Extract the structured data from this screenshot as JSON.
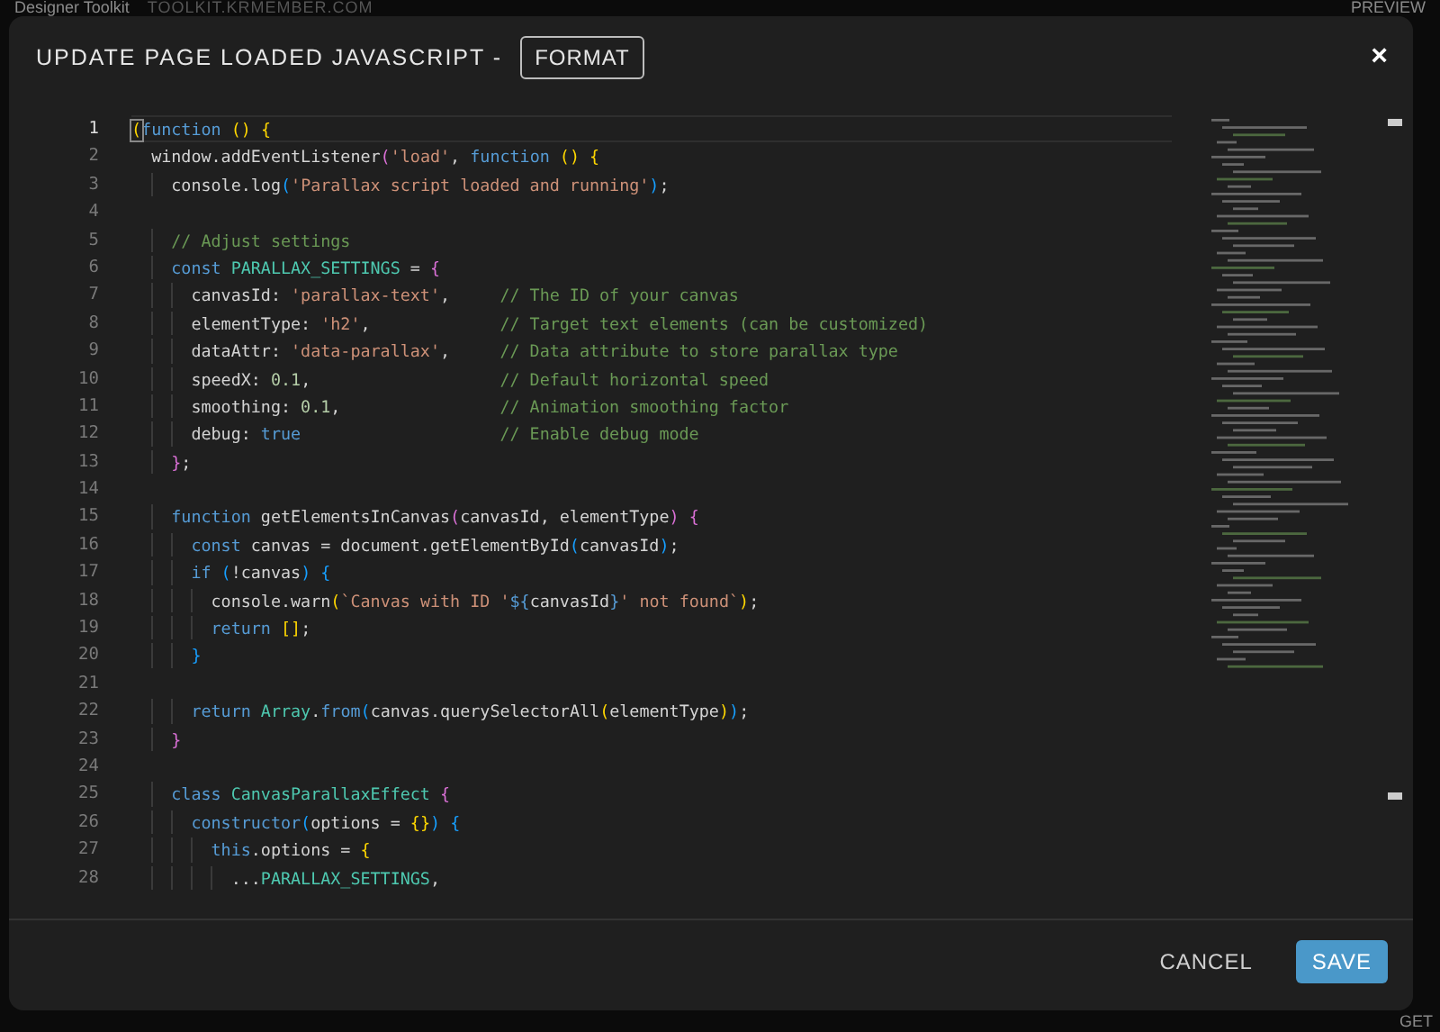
{
  "background": {
    "app_name": "Designer Toolkit",
    "domain": "TOOLKIT.KRMEMBER.COM",
    "preview": "PREVIEW",
    "corner_text": "GET"
  },
  "dialog": {
    "title": "UPDATE PAGE LOADED JAVASCRIPT -",
    "format_button": "FORMAT",
    "close": "×",
    "editor": {
      "lines": [
        {
          "number": "1",
          "selected": true,
          "tokens": [
            {
              "text": "(",
              "kind": "gold"
            },
            {
              "text": "function",
              "kind": "keyword"
            },
            {
              "text": " () {",
              "kind": "gold"
            }
          ]
        },
        {
          "number": "2",
          "selected": false,
          "tokens": [
            {
              "text": "  window.addEventListener",
              "kind": "plain"
            },
            {
              "text": "(",
              "kind": "violet"
            },
            {
              "text": "'load'",
              "kind": "string"
            },
            {
              "text": ", ",
              "kind": "plain"
            },
            {
              "text": "function",
              "kind": "keyword"
            },
            {
              "text": " () {",
              "kind": "gold"
            }
          ]
        },
        {
          "number": "3",
          "selected": false,
          "tokens": [
            {
              "text": "    console.log",
              "kind": "plain"
            },
            {
              "text": "(",
              "kind": "blue"
            },
            {
              "text": "'Parallax script loaded and running'",
              "kind": "string"
            },
            {
              "text": ")",
              "kind": "blue"
            },
            {
              "text": ";",
              "kind": "plain"
            }
          ]
        },
        {
          "number": "4",
          "selected": false
        },
        {
          "number": "5",
          "selected": false,
          "tokens": [
            {
              "text": "    // Adjust settings",
              "kind": "comment"
            }
          ]
        },
        {
          "number": "6",
          "selected": false,
          "tokens": [
            {
              "text": "    const",
              "kind": "keyword"
            },
            {
              "text": " PARALLAX_SETTINGS",
              "kind": "type"
            },
            {
              "text": " = ",
              "kind": "plain"
            },
            {
              "text": "{",
              "kind": "violet"
            }
          ]
        },
        {
          "number": "7",
          "selected": false,
          "tokens": [
            {
              "text": "      canvasId: ",
              "kind": "plain"
            },
            {
              "text": "'parallax-text'",
              "kind": "string"
            },
            {
              "text": ",     ",
              "kind": "plain"
            },
            {
              "text": "// The ID of your canvas",
              "kind": "comment"
            }
          ]
        },
        {
          "number": "8",
          "selected": false,
          "tokens": [
            {
              "text": "      elementType: ",
              "kind": "plain"
            },
            {
              "text": "'h2'",
              "kind": "string"
            },
            {
              "text": ",             ",
              "kind": "plain"
            },
            {
              "text": "// Target text elements (can be customized)",
              "kind": "comment"
            }
          ]
        },
        {
          "number": "9",
          "selected": false,
          "tokens": [
            {
              "text": "      dataAttr: ",
              "kind": "plain"
            },
            {
              "text": "'data-parallax'",
              "kind": "string"
            },
            {
              "text": ",     ",
              "kind": "plain"
            },
            {
              "text": "// Data attribute to store parallax type",
              "kind": "comment"
            }
          ]
        },
        {
          "number": "10",
          "selected": false,
          "tokens": [
            {
              "text": "      speedX: ",
              "kind": "plain"
            },
            {
              "text": "0.1",
              "kind": "number"
            },
            {
              "text": ",                   ",
              "kind": "plain"
            },
            {
              "text": "// Default horizontal speed",
              "kind": "comment"
            }
          ]
        },
        {
          "number": "11",
          "selected": false,
          "tokens": [
            {
              "text": "      smoothing: ",
              "kind": "plain"
            },
            {
              "text": "0.1",
              "kind": "number"
            },
            {
              "text": ",                ",
              "kind": "plain"
            },
            {
              "text": "// Animation smoothing factor",
              "kind": "comment"
            }
          ]
        },
        {
          "number": "12",
          "selected": false,
          "tokens": [
            {
              "text": "      debug: ",
              "kind": "plain"
            },
            {
              "text": "true",
              "kind": "keyword"
            },
            {
              "text": "                    // Enable debug mode",
              "kind": "comment"
            }
          ]
        },
        {
          "number": "13",
          "selected": false,
          "tokens": [
            {
              "text": "    }",
              "kind": "violet"
            },
            {
              "text": ";",
              "kind": "plain"
            }
          ]
        },
        {
          "number": "14",
          "selected": false
        },
        {
          "number": "15",
          "selected": false,
          "tokens": [
            {
              "text": "    function",
              "kind": "keyword"
            },
            {
              "text": " getElementsInCanvas",
              "kind": "plain"
            },
            {
              "text": "(",
              "kind": "violet"
            },
            {
              "text": "canvasId, elementType",
              "kind": "plain"
            },
            {
              "text": ")",
              "kind": "violet"
            },
            {
              "text": " {",
              "kind": "violet"
            }
          ]
        },
        {
          "number": "16",
          "selected": false,
          "tokens": [
            {
              "text": "      const",
              "kind": "keyword"
            },
            {
              "text": " canvas = document.getElementById",
              "kind": "plain"
            },
            {
              "text": "(",
              "kind": "blue"
            },
            {
              "text": "canvasId",
              "kind": "plain"
            },
            {
              "text": ")",
              "kind": "blue"
            },
            {
              "text": ";",
              "kind": "plain"
            }
          ]
        },
        {
          "number": "17",
          "selected": false,
          "tokens": [
            {
              "text": "      if",
              "kind": "keyword"
            },
            {
              "text": " (",
              "kind": "blue"
            },
            {
              "text": "!canvas",
              "kind": "plain"
            },
            {
              "text": ")",
              "kind": "blue"
            },
            {
              "text": " {",
              "kind": "blue"
            }
          ]
        },
        {
          "number": "18",
          "selected": false,
          "tokens": [
            {
              "text": "        console.warn",
              "kind": "plain"
            },
            {
              "text": "(",
              "kind": "gold"
            },
            {
              "text": "`Canvas with ID '",
              "kind": "string"
            },
            {
              "text": "${",
              "kind": "keyword"
            },
            {
              "text": "canvasId",
              "kind": "plain"
            },
            {
              "text": "}",
              "kind": "keyword"
            },
            {
              "text": "' not found`",
              "kind": "string"
            },
            {
              "text": ")",
              "kind": "gold"
            },
            {
              "text": ";",
              "kind": "plain"
            }
          ]
        },
        {
          "number": "19",
          "selected": false,
          "tokens": [
            {
              "text": "        return",
              "kind": "keyword"
            },
            {
              "text": " []",
              "kind": "gold"
            },
            {
              "text": ";",
              "kind": "plain"
            }
          ]
        },
        {
          "number": "20",
          "selected": false,
          "tokens": [
            {
              "text": "      }",
              "kind": "blue"
            }
          ]
        },
        {
          "number": "21",
          "selected": false
        },
        {
          "number": "22",
          "selected": false,
          "tokens": [
            {
              "text": "      return",
              "kind": "keyword"
            },
            {
              "text": " Array",
              "kind": "type"
            },
            {
              "text": ".",
              "kind": "plain"
            },
            {
              "text": "from",
              "kind": "keyword"
            },
            {
              "text": "(",
              "kind": "blue"
            },
            {
              "text": "canvas.querySelectorAll",
              "kind": "plain"
            },
            {
              "text": "(",
              "kind": "gold"
            },
            {
              "text": "elementType",
              "kind": "plain"
            },
            {
              "text": ")",
              "kind": "gold"
            },
            {
              "text": ")",
              "kind": "blue"
            },
            {
              "text": ";",
              "kind": "plain"
            }
          ]
        },
        {
          "number": "23",
          "selected": false,
          "tokens": [
            {
              "text": "    }",
              "kind": "violet"
            }
          ]
        },
        {
          "number": "24",
          "selected": false
        },
        {
          "number": "25",
          "selected": false,
          "tokens": [
            {
              "text": "    class",
              "kind": "keyword"
            },
            {
              "text": " CanvasParallaxEffect",
              "kind": "type"
            },
            {
              "text": " {",
              "kind": "violet"
            }
          ]
        },
        {
          "number": "26",
          "selected": false,
          "tokens": [
            {
              "text": "      constructor",
              "kind": "keyword"
            },
            {
              "text": "(",
              "kind": "blue"
            },
            {
              "text": "options = ",
              "kind": "plain"
            },
            {
              "text": "{}",
              "kind": "gold"
            },
            {
              "text": ")",
              "kind": "blue"
            },
            {
              "text": " {",
              "kind": "blue"
            }
          ]
        },
        {
          "number": "27",
          "selected": false,
          "tokens": [
            {
              "text": "        this",
              "kind": "keyword"
            },
            {
              "text": ".options = ",
              "kind": "plain"
            },
            {
              "text": "{",
              "kind": "gold"
            }
          ]
        },
        {
          "number": "28",
          "selected": false,
          "tokens": [
            {
              "text": "          ...",
              "kind": "plain"
            },
            {
              "text": "PARALLAX_SETTINGS",
              "kind": "type"
            },
            {
              "text": ",",
              "kind": "plain"
            }
          ]
        }
      ]
    },
    "cancel": "CANCEL",
    "save": "SAVE"
  }
}
